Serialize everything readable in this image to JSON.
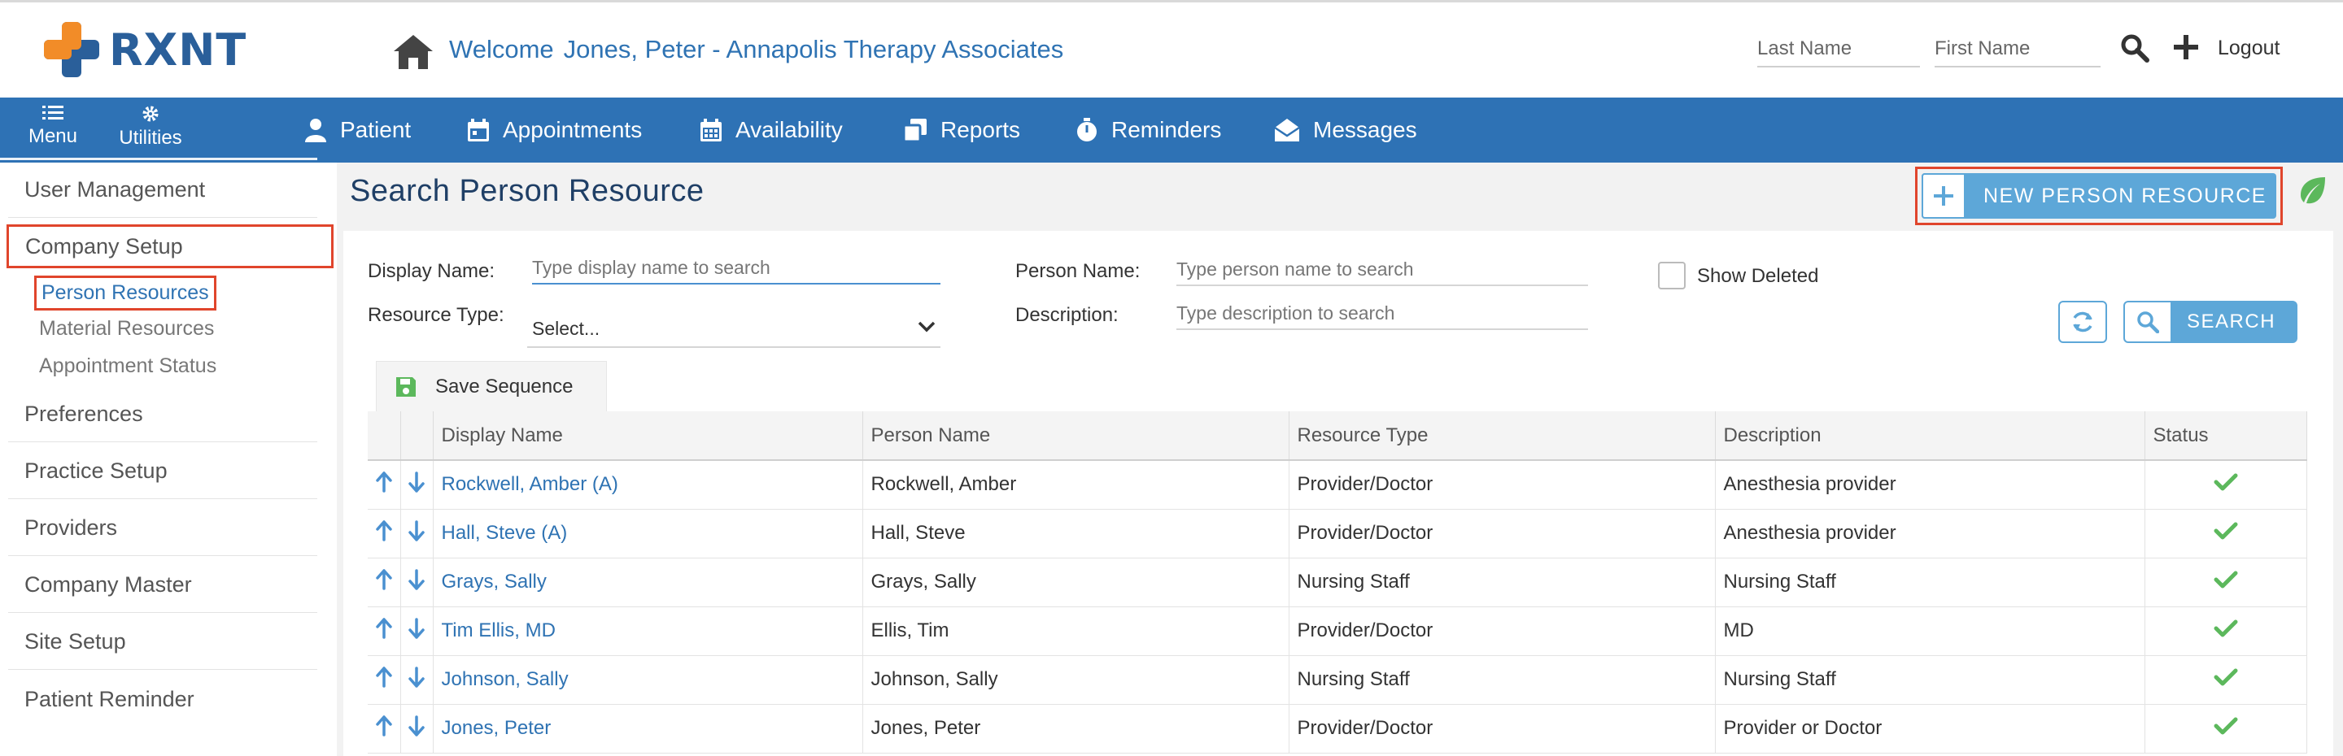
{
  "brand": {
    "name": "RXNT",
    "accent": "#2e72b5",
    "highlight": "#e0452c"
  },
  "header": {
    "welcome": "Welcome",
    "user": "Jones, Peter - Annapolis Therapy Associates",
    "last_name_placeholder": "Last Name",
    "first_name_placeholder": "First Name",
    "logout": "Logout"
  },
  "nav": {
    "menu": "Menu",
    "utilities": "Utilities",
    "items": [
      "Patient",
      "Appointments",
      "Availability",
      "Reports",
      "Reminders",
      "Messages"
    ]
  },
  "sidebar": {
    "items": [
      "User Management",
      "Company Setup",
      "Preferences",
      "Practice Setup",
      "Providers",
      "Company Master",
      "Site Setup",
      "Patient Reminder"
    ],
    "sub_items": [
      "Person Resources",
      "Material Resources",
      "Appointment Status"
    ]
  },
  "main": {
    "title": "Search Person Resource",
    "new_button": "NEW PERSON RESOURCE",
    "filters": {
      "display_name_label": "Display Name:",
      "display_name_placeholder": "Type display name to search",
      "resource_type_label": "Resource Type:",
      "resource_type_value": "Select...",
      "person_name_label": "Person Name:",
      "person_name_placeholder": "Type person name to search",
      "description_label": "Description:",
      "description_placeholder": "Type description to search",
      "show_deleted": "Show Deleted",
      "search_button": "SEARCH"
    },
    "save_sequence": "Save Sequence",
    "table": {
      "columns": [
        "Display Name",
        "Person Name",
        "Resource Type",
        "Description",
        "Status"
      ],
      "rows": [
        [
          "Rockwell, Amber (A)",
          "Rockwell, Amber",
          "Provider/Doctor",
          "Anesthesia provider"
        ],
        [
          "Hall, Steve (A)",
          "Hall, Steve",
          "Provider/Doctor",
          "Anesthesia provider"
        ],
        [
          "Grays, Sally",
          "Grays, Sally",
          "Nursing Staff",
          "Nursing Staff"
        ],
        [
          "Tim Ellis, MD",
          "Ellis, Tim",
          "Provider/Doctor",
          "MD"
        ],
        [
          "Johnson, Sally",
          "Johnson, Sally",
          "Nursing Staff",
          "Nursing Staff"
        ],
        [
          "Jones, Peter",
          "Jones, Peter",
          "Provider/Doctor",
          "Provider or Doctor"
        ]
      ],
      "status_color": "#5cb85c"
    }
  }
}
